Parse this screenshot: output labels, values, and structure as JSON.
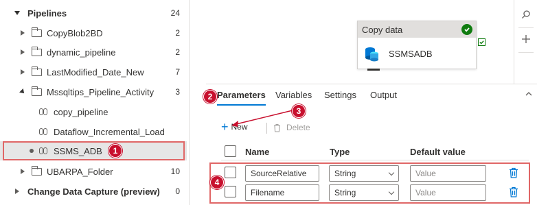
{
  "tree": {
    "root": {
      "label": "Pipelines",
      "count": "24"
    },
    "items": [
      {
        "label": "CopyBlob2BD",
        "count": "2"
      },
      {
        "label": "dynamic_pipeline",
        "count": "2"
      },
      {
        "label": "LastModified_Date_New",
        "count": "7"
      },
      {
        "label": "Mssqltips_Pipeline_Activity",
        "count": "3"
      }
    ],
    "children": [
      {
        "label": "copy_pipeline"
      },
      {
        "label": "Dataflow_Incremental_Load"
      },
      {
        "label": "SSMS_ADB"
      }
    ],
    "after": {
      "label": "UBARPA_Folder",
      "count": "10"
    },
    "cdc": {
      "label": "Change Data Capture (preview)",
      "count": "0"
    }
  },
  "activity": {
    "type_label": "Copy data",
    "name": "SSMSADB",
    "icon": "database-icon"
  },
  "toolbar_right": {
    "search_icon": "search-icon",
    "add_icon": "plus-icon"
  },
  "tabs": [
    "Parameters",
    "Variables",
    "Settings",
    "Output"
  ],
  "actions": {
    "new_label": "New",
    "delete_label": "Delete"
  },
  "columns": {
    "name": "Name",
    "type": "Type",
    "default": "Default value"
  },
  "params": [
    {
      "name": "SourceRelative",
      "type": "String",
      "default_placeholder": "Value"
    },
    {
      "name": "Filename",
      "type": "String",
      "default_placeholder": "Value"
    }
  ],
  "callouts": [
    "1",
    "2",
    "3",
    "4"
  ],
  "colors": {
    "accent": "#0078d4",
    "callout": "#c8102e",
    "highlight": "#e06666",
    "success": "#107c10"
  }
}
